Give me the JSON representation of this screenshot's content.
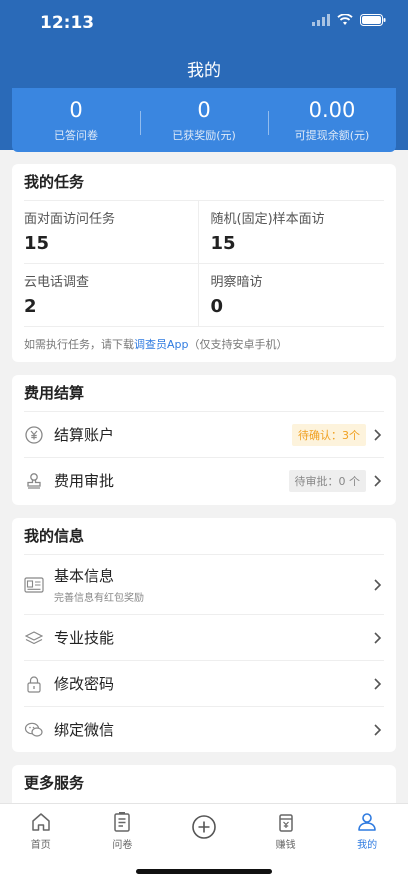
{
  "status": {
    "time": "12:13"
  },
  "nav": {
    "title": "我的"
  },
  "stats": [
    {
      "value": "0",
      "label": "已答问卷"
    },
    {
      "value": "0",
      "label": "已获奖励(元)"
    },
    {
      "value": "0.00",
      "label": "可提现余额(元)"
    }
  ],
  "tasks": {
    "title": "我的任务",
    "items": [
      {
        "label": "面对面访问任务",
        "value": "15"
      },
      {
        "label": "随机(固定)样本面访",
        "value": "15"
      },
      {
        "label": "云电话调查",
        "value": "2"
      },
      {
        "label": "明察暗访",
        "value": "0"
      }
    ],
    "note_prefix": "如需执行任务，请下载",
    "note_link": "调查员App",
    "note_suffix": "（仅支持安卓手机）"
  },
  "fees": {
    "title": "费用结算",
    "items": [
      {
        "label": "结算账户",
        "badge": "待确认：3个",
        "icon": "yuan-circle-icon"
      },
      {
        "label": "费用审批",
        "badge": "待审批：0 个",
        "icon": "stamp-icon"
      }
    ]
  },
  "info": {
    "title": "我的信息",
    "items": [
      {
        "label": "基本信息",
        "sub": "完善信息有红包奖励",
        "icon": "id-card-icon"
      },
      {
        "label": "专业技能",
        "icon": "layers-icon"
      },
      {
        "label": "修改密码",
        "icon": "lock-icon"
      },
      {
        "label": "绑定微信",
        "icon": "wechat-icon"
      }
    ]
  },
  "more": {
    "title": "更多服务"
  },
  "tabbar": [
    {
      "label": "首页",
      "icon": "home-icon"
    },
    {
      "label": "问卷",
      "icon": "document-icon"
    },
    {
      "label": "",
      "icon": "plus-circle-icon"
    },
    {
      "label": "赚钱",
      "icon": "wallet-icon"
    },
    {
      "label": "我的",
      "icon": "user-icon",
      "active": true
    }
  ],
  "colors": {
    "brand": "#2a6ab8",
    "accent": "#2f7be0",
    "warning": "#f0a020"
  }
}
